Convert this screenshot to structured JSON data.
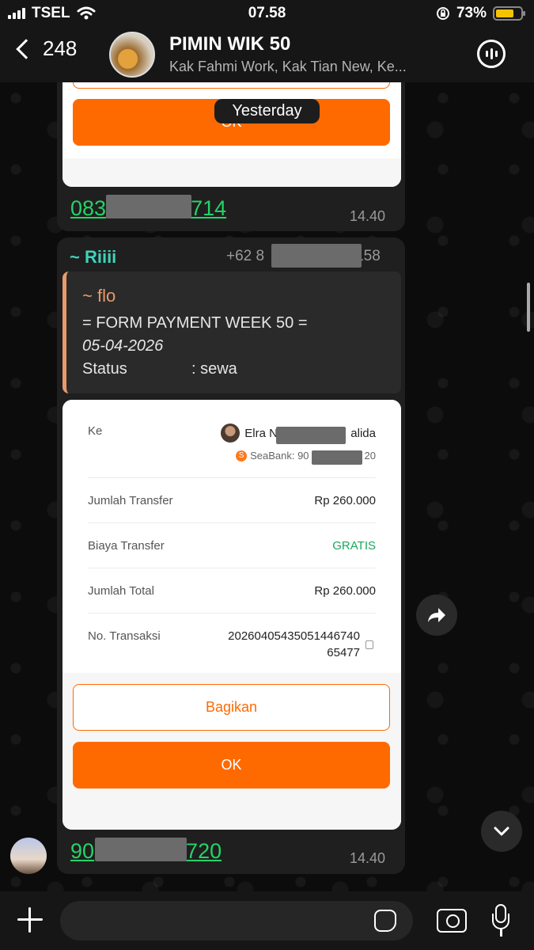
{
  "status_bar": {
    "carrier": "TSEL",
    "time": "07.58",
    "battery": "73%",
    "battery_level": 0.73
  },
  "header": {
    "back_count": "248",
    "title": "PIMIN WIK 50",
    "subtitle": "Kak Fahmi Work, Kak Tian New, Ke..."
  },
  "date_separator": "Yesterday",
  "message1": {
    "ok_label": "OK",
    "phone_start": "083",
    "phone_end": "714",
    "time": "14.40"
  },
  "message2": {
    "sender": "~ Riiii",
    "sender_phone_start": "+62 8",
    "sender_phone_end": "158",
    "quote": {
      "author": "~ flo",
      "line1": "= FORM PAYMENT WEEK 50 =",
      "line2": "05-04-2026",
      "status_label": "Status",
      "status_value": ": sewa"
    },
    "receipt": {
      "to_label": "Ke",
      "recipient_start": "Elra Ne",
      "recipient_end": "alida",
      "bank_start": "SeaBank: 90",
      "bank_end": "20",
      "rows": [
        {
          "label": "Jumlah Transfer",
          "value": "Rp 260.000"
        },
        {
          "label": "Biaya Transfer",
          "value": "GRATIS"
        },
        {
          "label": "Jumlah Total",
          "value": "Rp 260.000"
        }
      ],
      "tx_label": "No. Transaksi",
      "tx_line1": "20260405435051446740",
      "tx_line2": "65477",
      "share_label": "Bagikan",
      "ok_label": "OK"
    },
    "phone_start": "90",
    "phone_end": "720",
    "time": "14.40"
  },
  "input": {
    "placeholder": ""
  },
  "colors": {
    "accent_orange": "#ff6a00",
    "link_green": "#25d366",
    "sender_teal": "#3fd3b8",
    "quote_orange": "#e89a6a",
    "gratis_green": "#1aa85a"
  }
}
